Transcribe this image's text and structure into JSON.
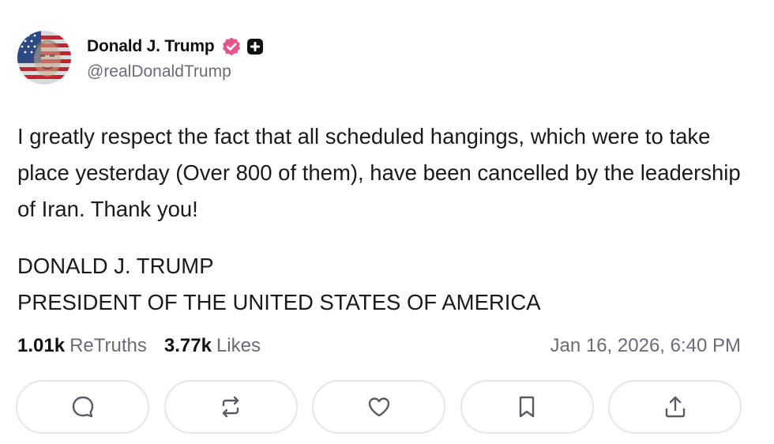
{
  "author": {
    "display_name": "Donald J. Trump",
    "handle": "@realDonaldTrump",
    "avatar_icon": "flag-portrait-avatar",
    "verified_icon": "verified-badge-icon",
    "verified_color": "#e8558e",
    "plus_icon": "plus-badge-icon"
  },
  "post": {
    "text": "I greatly respect the fact that all scheduled hangings, which were to take place yesterday (Over 800 of them), have been cancelled by the leadership of Iran. Thank you!",
    "signature_line1": "DONALD J. TRUMP",
    "signature_line2": "PRESIDENT OF THE UNITED STATES OF AMERICA"
  },
  "stats": {
    "retruths_count": "1.01k",
    "retruths_label": "ReTruths",
    "likes_count": "3.77k",
    "likes_label": "Likes",
    "timestamp": "Jan 16, 2026, 6:40 PM"
  },
  "actions": [
    {
      "name": "reply",
      "icon": "reply-bubble-icon"
    },
    {
      "name": "retruth",
      "icon": "retruth-arrows-icon"
    },
    {
      "name": "like",
      "icon": "heart-icon"
    },
    {
      "name": "bookmark",
      "icon": "bookmark-icon"
    },
    {
      "name": "share",
      "icon": "share-upload-icon"
    }
  ],
  "colors": {
    "text_primary": "#111111",
    "text_secondary": "#6b6b77",
    "border": "#e6e6ea",
    "icon": "#5a5a66"
  }
}
